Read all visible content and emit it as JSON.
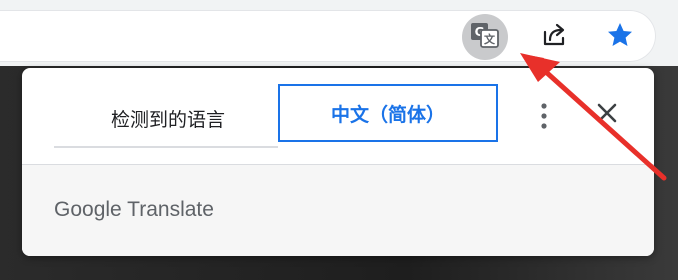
{
  "toolbar": {
    "translate_icon": "translate-page-icon",
    "share_icon": "share-icon",
    "bookmark_icon": "star-icon",
    "accent_color": "#1a73e8",
    "translate_active_bg": "#c9cacc"
  },
  "translate_popup": {
    "tabs": [
      {
        "label": "检测到的语言",
        "selected": false
      },
      {
        "label": "中文（简体）",
        "selected": true
      }
    ],
    "menu_icon": "more-vert-icon",
    "close_icon": "close-icon",
    "branding": "Google Translate"
  },
  "annotation": {
    "arrow_color": "#e8302a"
  }
}
